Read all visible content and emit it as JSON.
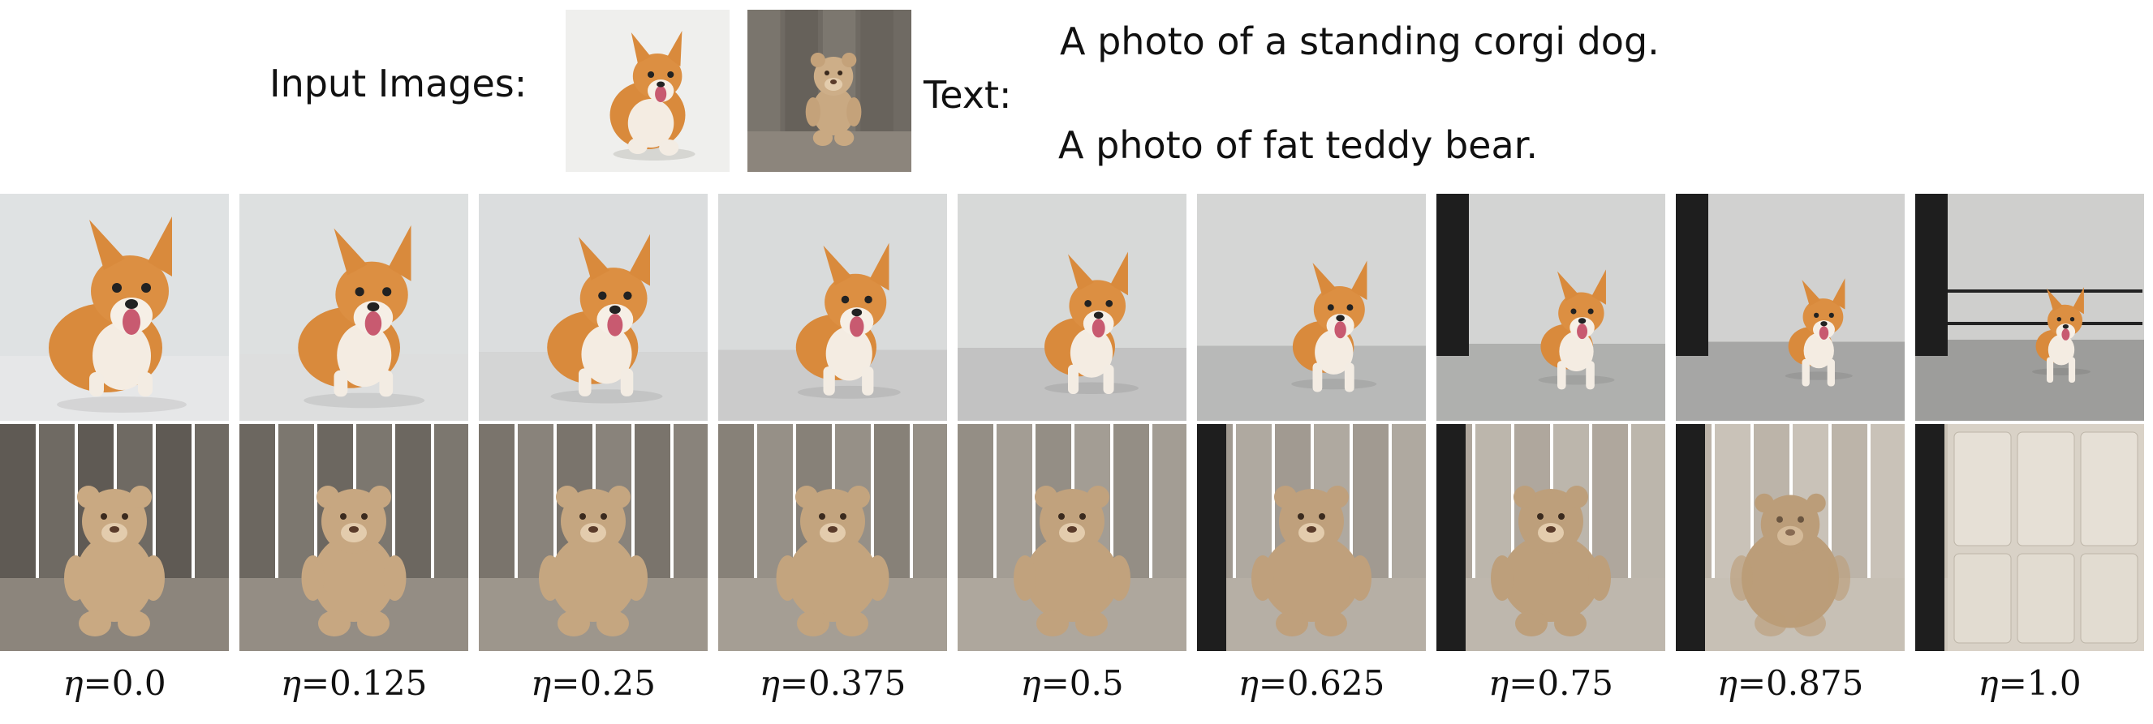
{
  "header": {
    "input_label": "Input Images:",
    "text_label": "Text:",
    "prompts": [
      "A photo of a standing corgi dog.",
      "A photo of fat teddy bear."
    ]
  },
  "input_images": [
    {
      "icon": "corgi-photo"
    },
    {
      "icon": "teddy-bear-photo"
    }
  ],
  "interpolation": {
    "symbol": "η",
    "values": [
      "=0.0",
      "=0.125",
      "=0.25",
      "=0.375",
      "=0.5",
      "=0.625",
      "=0.75",
      "=0.875",
      "=1.0"
    ]
  },
  "colors": {
    "corgi_orange": "#d98a3c",
    "bear_tan": "#c9a982",
    "wood_gray": "#6f6a63",
    "studio_gray": "#c7c9cb"
  }
}
